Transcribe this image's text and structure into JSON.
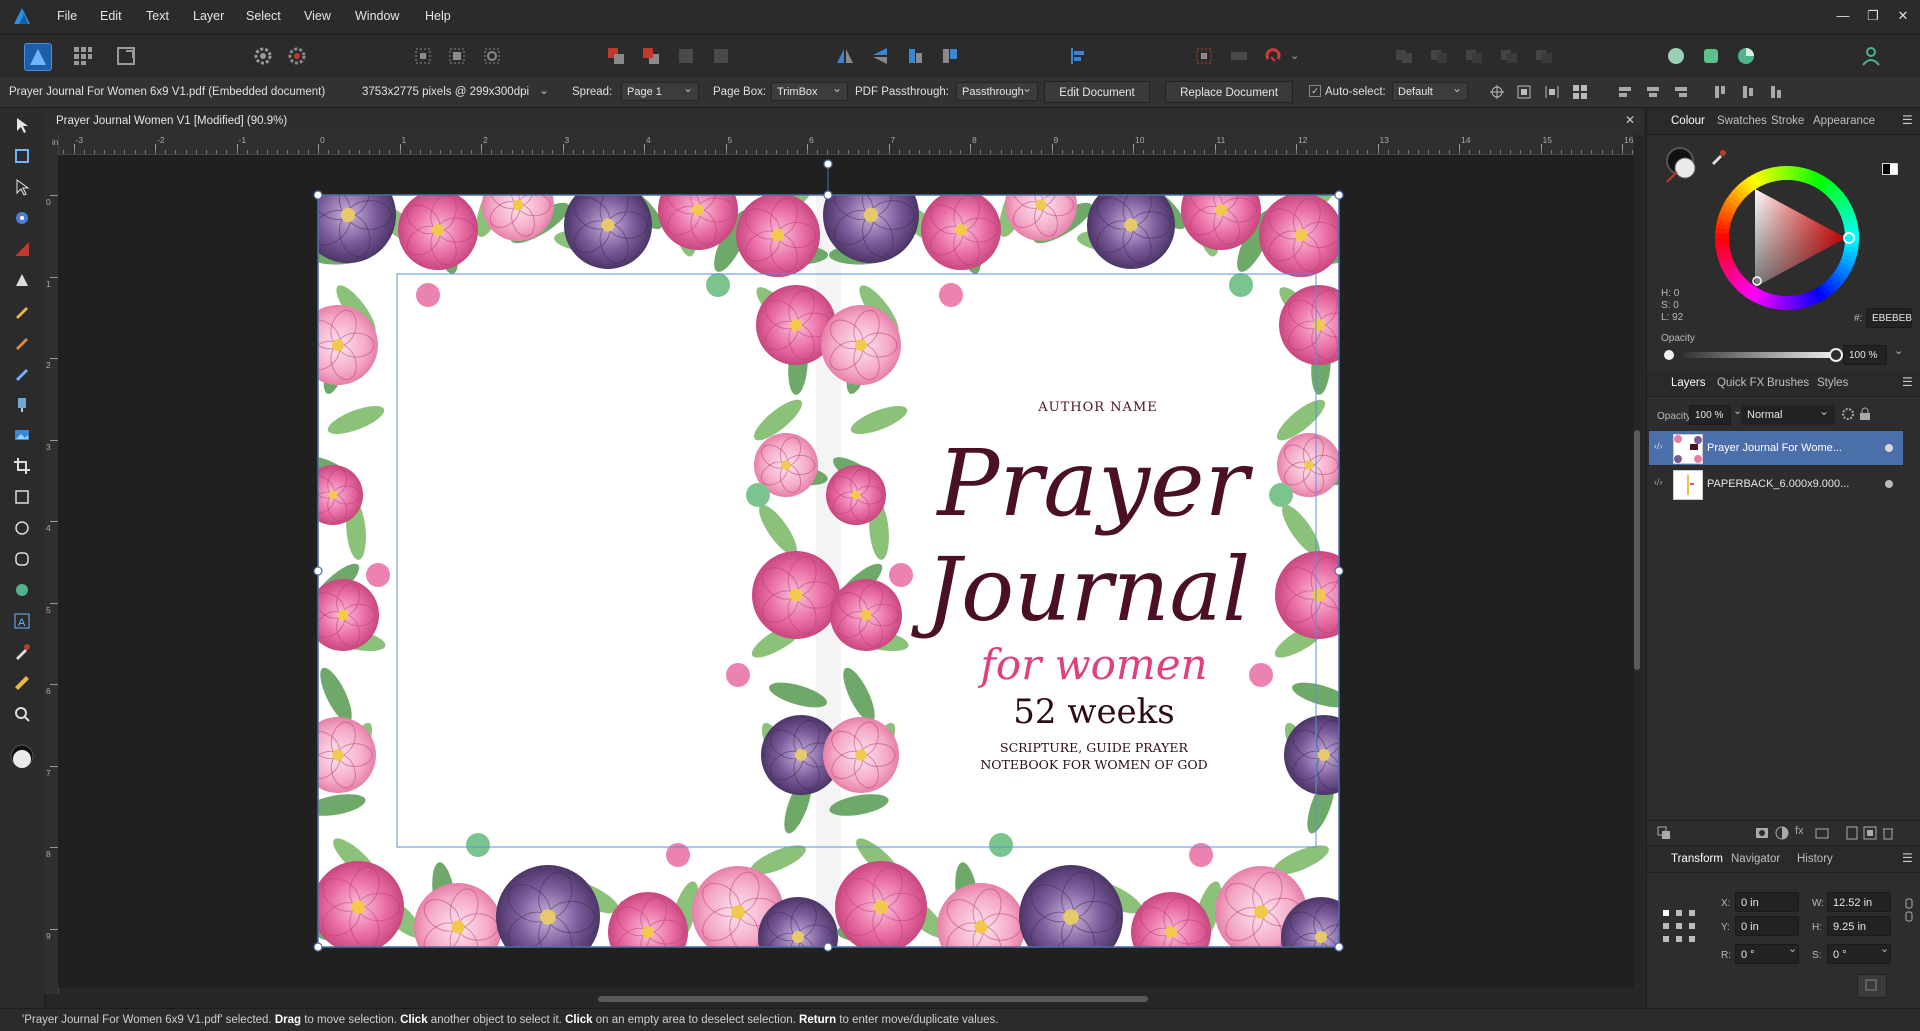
{
  "menubar": {
    "items": [
      "File",
      "Edit",
      "Text",
      "Layer",
      "Select",
      "View",
      "Window",
      "Help"
    ],
    "window_controls": [
      "—",
      "❐",
      "✕"
    ]
  },
  "context_bar": {
    "document_label": "Prayer Journal For Women 6x9 V1.pdf (Embedded document)",
    "pixel_info": "3753x2775 pixels @ 299x300dpi",
    "spread_label": "Spread:",
    "spread_value": "Page 1",
    "pagebox_label": "Page Box:",
    "pagebox_value": "TrimBox",
    "passthrough_label": "PDF Passthrough:",
    "passthrough_value": "Passthrough",
    "edit_document": "Edit Document",
    "replace_document": "Replace Document",
    "autoselect_label": "Auto-select:",
    "autoselect_value": "Default"
  },
  "document": {
    "tab_title": "Prayer Journal Women V1 [Modified] (90.9%)",
    "ruler_unit": "in",
    "ruler_h_labels": [
      "-3",
      "-2",
      "-1",
      "0",
      "1",
      "2",
      "3",
      "4",
      "5",
      "6",
      "7",
      "8",
      "9",
      "10",
      "11",
      "12",
      "13",
      "14",
      "15",
      "16"
    ],
    "ruler_v_labels": [
      "0",
      "1",
      "2",
      "3",
      "4",
      "5",
      "6",
      "7",
      "8",
      "9"
    ]
  },
  "cover": {
    "author": "AUTHOR NAME",
    "title_line1": "Prayer",
    "title_line2": "Journal",
    "subtitle": "for women",
    "weeks": "52 weeks",
    "tagline1": "SCRIPTURE, GUIDE PRAYER",
    "tagline2": "NOTEBOOK FOR WOMEN OF GOD"
  },
  "colour_panel": {
    "tabs": [
      "Colour",
      "Swatches",
      "Stroke",
      "Appearance"
    ],
    "hsl": [
      "H: 0",
      "S: 0",
      "L: 92"
    ],
    "hex_prefix": "#:",
    "hex_value": "EBEBEB",
    "opacity_label": "Opacity",
    "opacity_value": "100 %"
  },
  "layers_panel": {
    "tabs": [
      "Layers",
      "Quick FX",
      "Brushes",
      "Styles"
    ],
    "opacity_label": "Opacity:",
    "opacity_value": "100 %",
    "blend_mode": "Normal",
    "layers": [
      {
        "name": "Prayer Journal For Wome...",
        "selected": true
      },
      {
        "name": "PAPERBACK_6.000x9.000...",
        "selected": false
      }
    ]
  },
  "transform_panel": {
    "tabs": [
      "Transform",
      "Navigator",
      "History"
    ],
    "x_label": "X:",
    "x_value": "0 in",
    "y_label": "Y:",
    "y_value": "0 in",
    "w_label": "W:",
    "w_value": "12.52 in",
    "h_label": "H:",
    "h_value": "9.25 in",
    "r_label": "R:",
    "r_value": "0 °",
    "s_label": "S:",
    "s_value": "0 °"
  },
  "status": {
    "p1": "'Prayer Journal For Women 6x9 V1.pdf' selected. ",
    "b1": "Drag",
    "p2": " to move selection. ",
    "b2": "Click",
    "p3": " another object to select it. ",
    "b3": "Click",
    "p4": " on an empty area to deselect selection. ",
    "b4": "Return",
    "p5": " to enter move/duplicate values."
  },
  "colors": {
    "accent": "#2f7fd1",
    "selection": "#4b6fa8",
    "title_plum": "#4a1026",
    "pink_script": "#e0407f"
  }
}
